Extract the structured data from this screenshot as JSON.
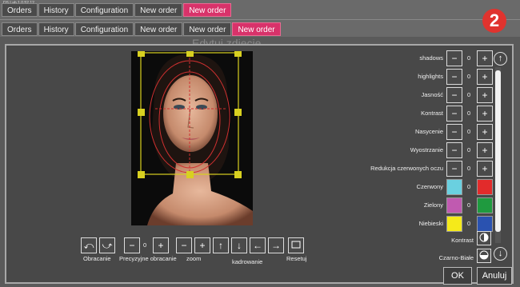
{
  "app": {
    "title": "DS Lab 1.0.52.12"
  },
  "tabs_row1": [
    "Orders",
    "History",
    "Configuration",
    "New order",
    "New order"
  ],
  "tabs_row2": [
    "Orders",
    "History",
    "Configuration",
    "New order",
    "New order",
    "New order"
  ],
  "dialog": {
    "title_hidden": "Edytuj zdjęcie..."
  },
  "badge": "2",
  "adjustments": [
    {
      "label": "shadows",
      "value": "0"
    },
    {
      "label": "highlights",
      "value": "0"
    },
    {
      "label": "Jasność",
      "value": "0"
    },
    {
      "label": "Kontrast",
      "value": "0"
    },
    {
      "label": "Nasycenie",
      "value": "0"
    },
    {
      "label": "Wyostrzanie",
      "value": "0"
    },
    {
      "label": "Redukcja czerwonych oczu",
      "value": "0"
    }
  ],
  "colors": [
    {
      "label": "Czerwony",
      "value": "0",
      "left": "#6ad0e0",
      "right": "#e22b2b"
    },
    {
      "label": "Zielony",
      "value": "0",
      "left": "#c05ab0",
      "right": "#1f9a3f"
    },
    {
      "label": "Niebieski",
      "value": "0",
      "left": "#f5ea1a",
      "right": "#2a52b0"
    }
  ],
  "toggles": [
    {
      "label": "Kontrast"
    },
    {
      "label": "Czarno-Białe"
    }
  ],
  "toolbar": {
    "rotate_label": "Obracanie",
    "precise_label": "Precyzyjne obracanie",
    "precise_value": "0",
    "zoom_label": "zoom",
    "crop_label": "kadrowanie",
    "reset_label": "Resetuj"
  },
  "buttons": {
    "ok": "OK",
    "cancel": "Anuluj"
  }
}
